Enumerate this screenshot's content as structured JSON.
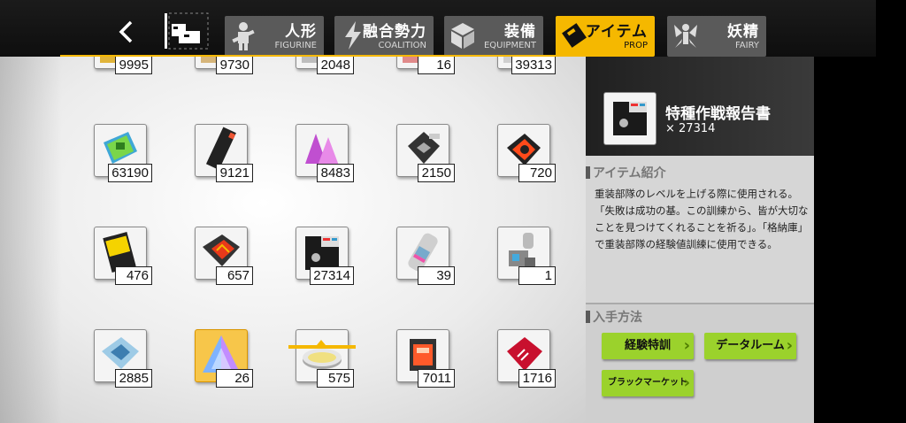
{
  "nav": {
    "back_label": "<",
    "tabs": [
      {
        "id": "figurine",
        "label_jp": "人形",
        "label_en": "FIGURINE",
        "icon": "figurine-icon",
        "active": false
      },
      {
        "id": "coalition",
        "label_jp": "融合勢力",
        "label_en": "COALITION",
        "icon": "lightning-icon",
        "active": false
      },
      {
        "id": "equipment",
        "label_jp": "装備",
        "label_en": "EQUIPMENT",
        "icon": "cube-icon",
        "active": false
      },
      {
        "id": "prop",
        "label_jp": "アイテム",
        "label_en": "PROP",
        "icon": "prop-icon",
        "active": true
      },
      {
        "id": "fairy",
        "label_jp": "妖精",
        "label_en": "FAIRY",
        "icon": "fairy-icon",
        "active": false
      }
    ]
  },
  "items_top_row": [
    "9995",
    "9730",
    "2048",
    "16",
    "39313"
  ],
  "items": [
    {
      "count": "63190",
      "icon": "chip-green"
    },
    {
      "count": "9121",
      "icon": "card-black"
    },
    {
      "count": "8483",
      "icon": "crystal-pink"
    },
    {
      "count": "2150",
      "icon": "gear-box"
    },
    {
      "count": "720",
      "icon": "core-red"
    },
    {
      "count": "476",
      "icon": "book-yellow"
    },
    {
      "count": "657",
      "icon": "crate-red"
    },
    {
      "count": "27314",
      "icon": "floppy-disk",
      "selected": true
    },
    {
      "count": "39",
      "icon": "canister"
    },
    {
      "count": "1",
      "icon": "figure-toy"
    },
    {
      "count": "2885",
      "icon": "frame-blue"
    },
    {
      "count": "26",
      "icon": "prism-blue",
      "gold": true
    },
    {
      "count": "575",
      "icon": "disc-silver"
    },
    {
      "count": "7011",
      "icon": "memory-chip"
    },
    {
      "count": "1716",
      "icon": "card-red"
    }
  ],
  "detail": {
    "name": "特種作戦報告書",
    "quantity": "× 27314",
    "description_title": "アイテム紹介",
    "description": "重装部隊のレベルを上げる際に使用される。「失敗は成功の基。この訓練から、皆が大切なことを見つけてくれることを祈る」。「格納庫」で重装部隊の経験値訓練に使用できる。",
    "acquire_title": "入手方法",
    "buttons": [
      "経験特訓",
      "データルーム",
      "ブラックマーケット"
    ]
  },
  "colors": {
    "accent": "#f5b800",
    "tab_inactive": "#5a5a5a",
    "button_green": "#9bd22c"
  }
}
